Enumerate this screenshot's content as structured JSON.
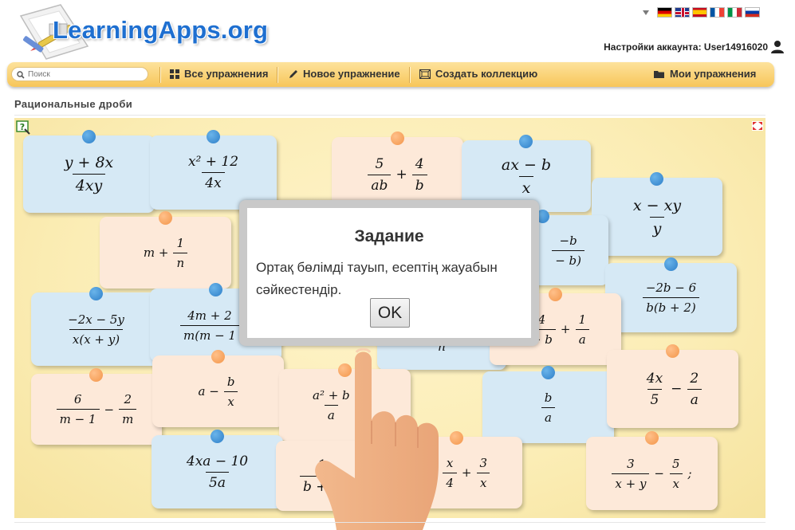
{
  "header": {
    "logo_text": "LearningApps.org",
    "account_label": "Настройки аккаунта: User14916020",
    "language_flags": [
      "de-flag",
      "gb-flag",
      "es-flag",
      "fr-flag",
      "it-flag",
      "ru-flag"
    ]
  },
  "nav": {
    "search_placeholder": "Поиск",
    "all_exercises": "Все упражнения",
    "new_exercise": "Новое упражнение",
    "create_collection": "Создать коллекцию",
    "my_exercises": "Мои упражнения"
  },
  "page": {
    "title": "Рациональные дроби"
  },
  "modal": {
    "title": "Задание",
    "text": "Ортақ бөлімді тауып, есептің жауабын сәйкестендір.",
    "ok_label": "OK"
  },
  "cards": {
    "c1": {
      "num": "y + 8x",
      "den": "4xy"
    },
    "c2": {
      "num": "x² + 12",
      "den": "4x"
    },
    "c3": {
      "n1": "5",
      "d1": "ab",
      "op": "+",
      "n2": "4",
      "d2": "b"
    },
    "c4": {
      "num": "ax − b",
      "den": "x"
    },
    "c5": {
      "num": "x − xy",
      "den": "y"
    },
    "c6": {
      "pre": "m +",
      "num": "1",
      "den": "n"
    },
    "c7": {
      "num": "−b",
      "den": "− b)"
    },
    "c8": {
      "num": "−2b − 6",
      "den": "b(b + 2)"
    },
    "c9": {
      "num": "−2x − 5y",
      "den": "x(x + y)"
    },
    "c10": {
      "num": "4m + 2",
      "den": "m(m − 1"
    },
    "c11": {
      "den": "n"
    },
    "c12": {
      "n1": "4",
      "d1": "− b",
      "op": "+",
      "n2": "1",
      "d2": "a"
    },
    "c13": {
      "n1": "6",
      "d1": "m − 1",
      "op": "−",
      "n2": "2",
      "d2": "m"
    },
    "c14": {
      "pre": "a −",
      "num": "b",
      "den": "x"
    },
    "c15": {
      "num": "a² + b",
      "den": "a"
    },
    "c16": {
      "num": "b",
      "den": "a"
    },
    "c17": {
      "n1": "4x",
      "d1": "5",
      "op": "−",
      "n2": "2",
      "d2": "a"
    },
    "c18": {
      "num": "4xa − 10",
      "den": "5a"
    },
    "c19": {
      "num": "1",
      "den": "b + 2"
    },
    "c20": {
      "n1": "x",
      "d1": "4",
      "op": "+",
      "n2": "3",
      "d2": "x"
    },
    "c21": {
      "n1": "3",
      "d1": "x + y",
      "op": "−",
      "n2": "5",
      "d2": "x",
      "post": ";"
    }
  }
}
